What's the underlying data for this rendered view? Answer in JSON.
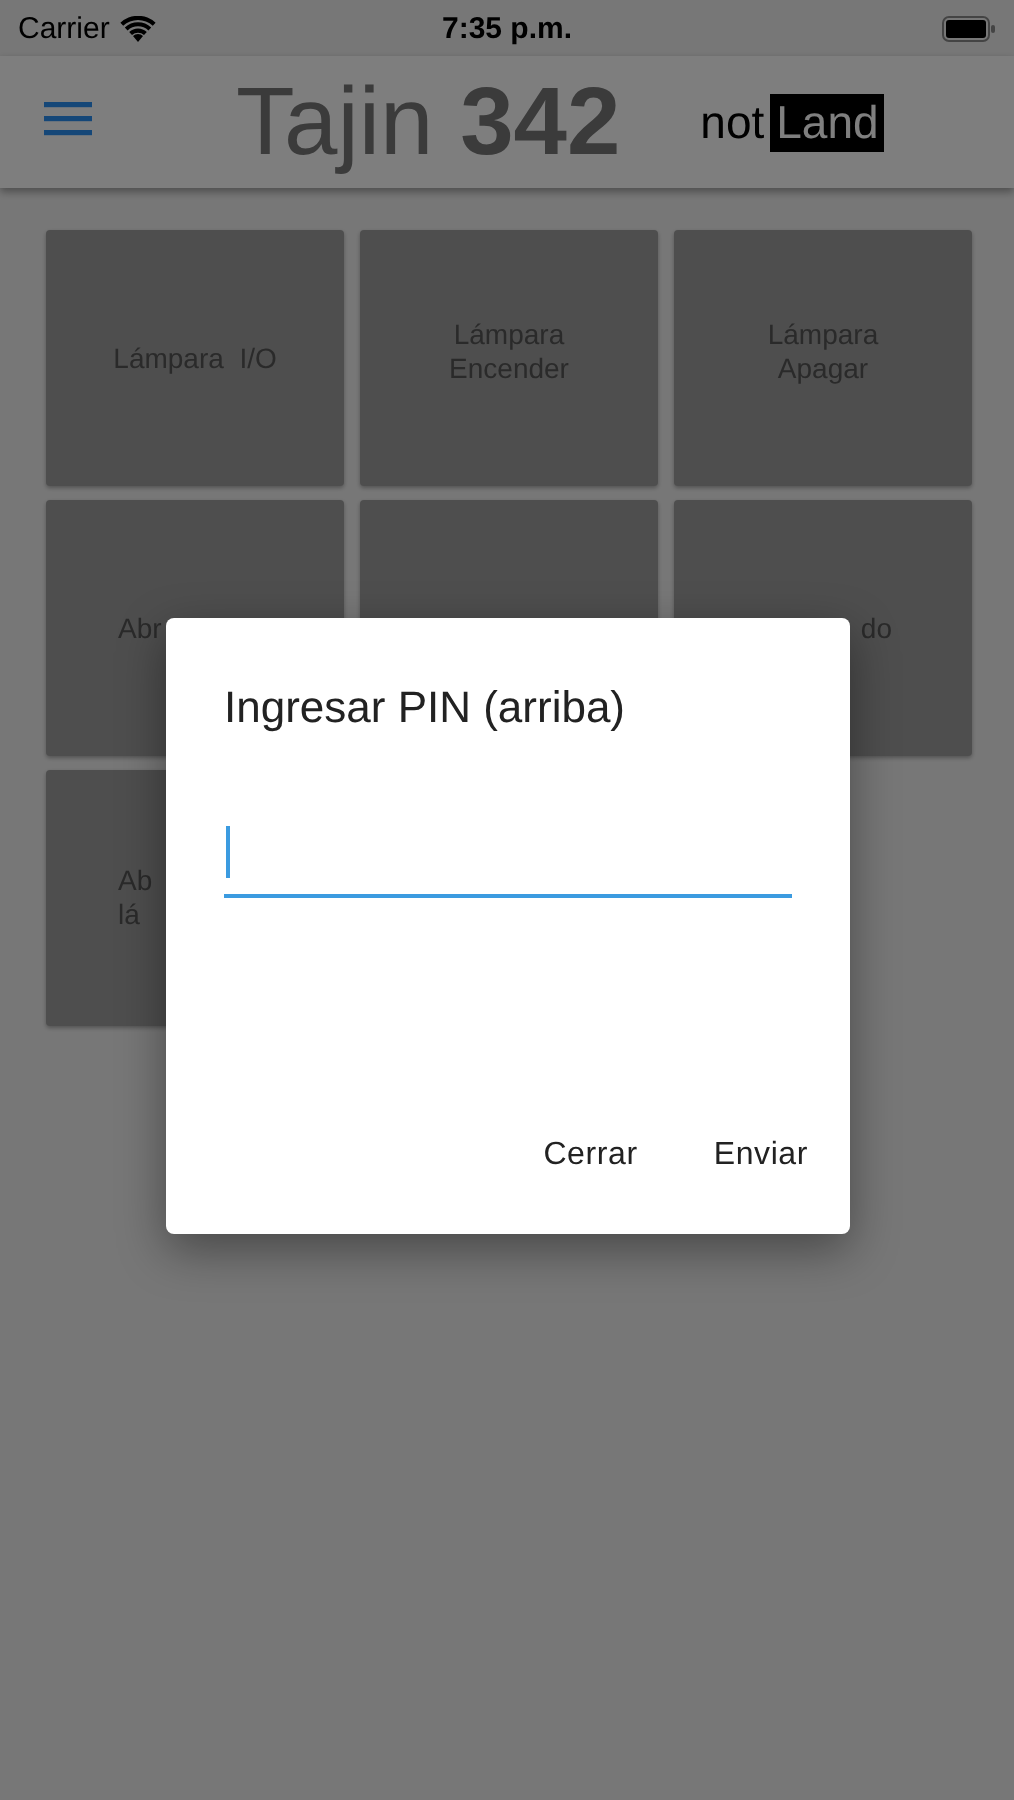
{
  "status_bar": {
    "carrier": "Carrier",
    "time": "7:35 p.m."
  },
  "header": {
    "title": "Tajin **342**",
    "logo": {
      "plain": "not",
      "boxed": "Land"
    }
  },
  "tiles": [
    {
      "kind": "labeled",
      "lines": [
        "Lámpara  I/O"
      ]
    },
    {
      "kind": "labeled",
      "lines": [
        "Lámpara",
        "Encender"
      ]
    },
    {
      "kind": "labeled",
      "lines": [
        "Lámpara",
        "Apagar"
      ]
    },
    {
      "kind": "labeled",
      "lines": [
        "Abr"
      ]
    },
    {
      "kind": "blank"
    },
    {
      "kind": "labeled",
      "lines": [
        "do"
      ]
    },
    {
      "kind": "labeled",
      "lines": [
        "Ab",
        "lá"
      ]
    }
  ],
  "dialog": {
    "title": "Ingresar PIN (arriba)",
    "pin_field": {
      "focused": true
    },
    "buttons": [
      "Cerrar",
      "Enviar"
    ]
  }
}
